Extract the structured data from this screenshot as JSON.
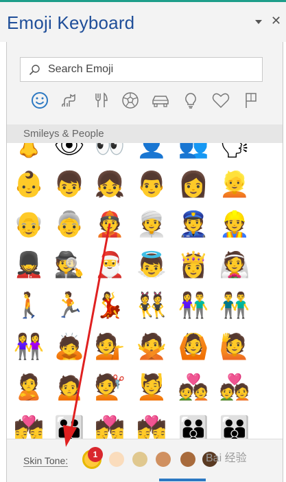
{
  "window": {
    "title": "Emoji Keyboard",
    "dropdown_icon": "chevron-down-icon",
    "close_icon": "close-icon",
    "close_glyph": "✕"
  },
  "search": {
    "placeholder": "Search Emoji"
  },
  "categories": [
    {
      "name": "smileys",
      "icon": "smiley-icon",
      "selected": true
    },
    {
      "name": "animals",
      "icon": "animal-icon"
    },
    {
      "name": "food",
      "icon": "fork-knife-icon"
    },
    {
      "name": "activity",
      "icon": "soccer-ball-icon"
    },
    {
      "name": "travel",
      "icon": "car-icon"
    },
    {
      "name": "objects",
      "icon": "lightbulb-icon"
    },
    {
      "name": "symbols",
      "icon": "heart-icon"
    },
    {
      "name": "flags",
      "icon": "flag-icon"
    }
  ],
  "section": {
    "title": "Smileys & People"
  },
  "emoji_rows": [
    [
      "👃",
      "👁",
      "👀",
      "👤",
      "👥",
      "🗣"
    ],
    [
      "👶",
      "👦",
      "👧",
      "👨",
      "👩",
      "👱"
    ],
    [
      "👴",
      "👵",
      "👲",
      "👳",
      "👮",
      "👷"
    ],
    [
      "💂",
      "🕵",
      "🎅",
      "👼",
      "👸",
      "👰"
    ],
    [
      "🚶",
      "🏃",
      "💃",
      "👯",
      "👫",
      "👬"
    ],
    [
      "👭",
      "🙇",
      "💁",
      "🙅",
      "🙆",
      "🙋"
    ],
    [
      "🙎",
      "🙍",
      "💇",
      "💆",
      "💑",
      "💑"
    ],
    [
      "💏",
      "👪",
      "💏",
      "💏",
      "👪",
      "👪"
    ]
  ],
  "footer": {
    "skin_tone_label": "Skin Tone:",
    "badge_number": "1",
    "watermark": "Bai 经验"
  },
  "skin_tones": [
    {
      "name": "default",
      "color": "#ffc93c",
      "selected": true
    },
    {
      "name": "light",
      "color": "#fadcbc"
    },
    {
      "name": "medium-light",
      "color": "#e0c88f"
    },
    {
      "name": "medium",
      "color": "#d09060"
    },
    {
      "name": "medium-dark",
      "color": "#a86b3c"
    },
    {
      "name": "dark",
      "color": "#5a3a22"
    }
  ],
  "colors": {
    "accent": "#1f4e99",
    "annotation": "#e02020",
    "scroll_indicator": "#2b78c2"
  }
}
